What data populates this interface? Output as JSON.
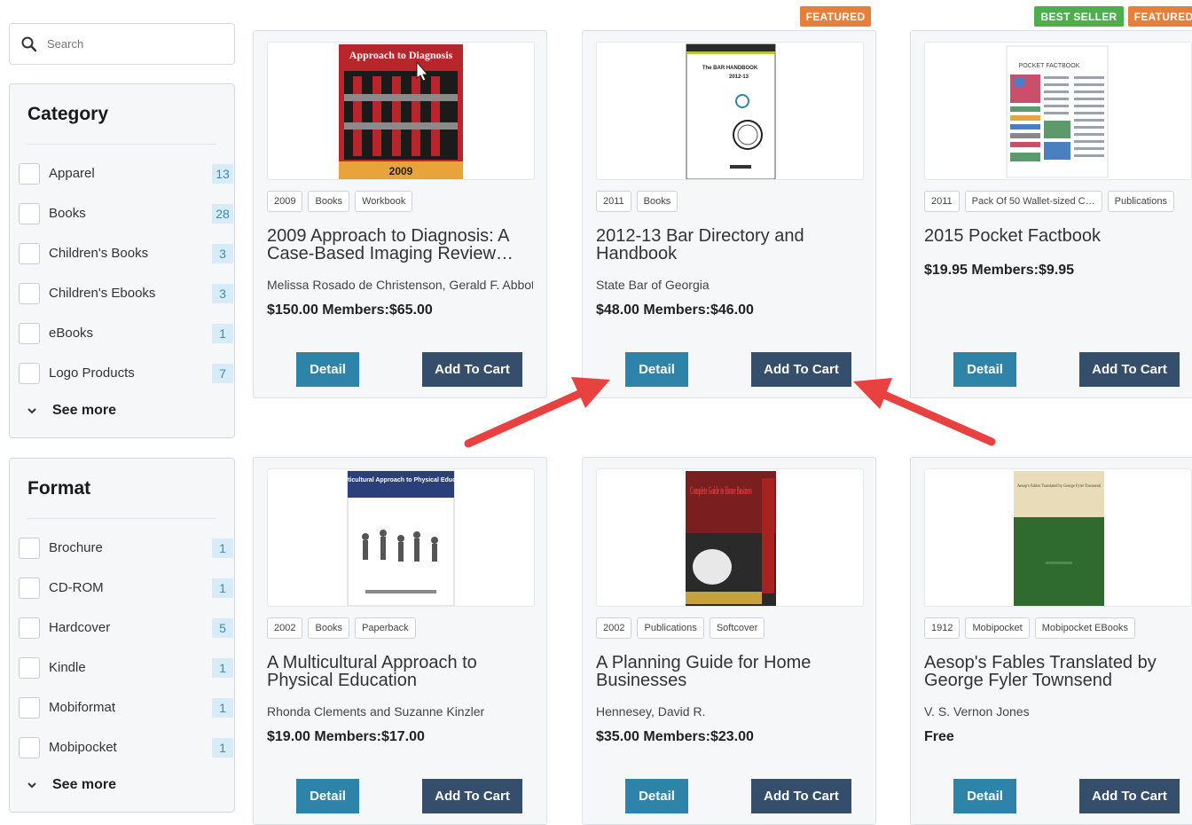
{
  "search": {
    "placeholder": "Search"
  },
  "category": {
    "title": "Category",
    "items": [
      {
        "label": "Apparel",
        "count": "13"
      },
      {
        "label": "Books",
        "count": "28"
      },
      {
        "label": "Children's Books",
        "count": "3"
      },
      {
        "label": "Children's Ebooks",
        "count": "3"
      },
      {
        "label": "eBooks",
        "count": "1"
      },
      {
        "label": "Logo Products",
        "count": "7"
      }
    ],
    "see_more": "See more"
  },
  "format": {
    "title": "Format",
    "items": [
      {
        "label": "Brochure",
        "count": "1"
      },
      {
        "label": "CD-ROM",
        "count": "1"
      },
      {
        "label": "Hardcover",
        "count": "5"
      },
      {
        "label": "Kindle",
        "count": "1"
      },
      {
        "label": "Mobiformat",
        "count": "1"
      },
      {
        "label": "Mobipocket",
        "count": "1"
      }
    ],
    "see_more": "See more"
  },
  "buttons": {
    "detail": "Detail",
    "add_to_cart": "Add To Cart"
  },
  "badges": {
    "featured": "FEATURED",
    "best_seller": "BEST SELLER"
  },
  "products": [
    {
      "tags": [
        "2009",
        "Books",
        "Workbook"
      ],
      "title": "2009 Approach to Diagnosis: A Case-Based Imaging Review…",
      "author": "Melissa Rosado de Christenson, Gerald F. Abbott",
      "price": "$150.00 Members:$65.00",
      "cover_title": "Approach to Diagnosis",
      "cover_year": "2009"
    },
    {
      "tags": [
        "2011",
        "Books"
      ],
      "title": "2012-13 Bar Directory and Handbook",
      "author": "State Bar of Georgia",
      "price": "$48.00 Members:$46.00",
      "cover_title": "The BAR HANDBOOK",
      "cover_year": "2012-13"
    },
    {
      "tags": [
        "2011",
        "Pack Of 50 Wallet-sized C…",
        "Publications"
      ],
      "title": "2015 Pocket Factbook",
      "author": "",
      "price": "$19.95 Members:$9.95",
      "cover_title": "POCKET FACTBOOK"
    },
    {
      "tags": [
        "2002",
        "Books",
        "Paperback"
      ],
      "title": "A Multicultural Approach to Physical Education",
      "author": "Rhonda Clements and Suzanne Kinzler",
      "price": "$19.00 Members:$17.00",
      "cover_title": "A Multicultural Approach to Physical Education"
    },
    {
      "tags": [
        "2002",
        "Publications",
        "Softcover"
      ],
      "title": "A Planning Guide for Home Businesses",
      "author": "Hennesey, David R.",
      "price": "$35.00 Members:$23.00",
      "cover_title": "Complete Guide to Home Business"
    },
    {
      "tags": [
        "1912",
        "Mobipocket",
        "Mobipocket EBooks"
      ],
      "title": "Aesop's Fables Translated by George Fyler Townsend",
      "author": "V. S. Vernon Jones",
      "price": "Free",
      "cover_title": "Aesop's Fables Translated by George Fyler Townsend"
    }
  ],
  "colors": {
    "detail_button": "#2e84a8",
    "cart_button": "#344e6c",
    "featured_badge": "#e57f3a",
    "best_seller_badge": "#4cae4c",
    "annotation_arrow": "#e8413f",
    "count_badge": "#d7ecf6"
  }
}
